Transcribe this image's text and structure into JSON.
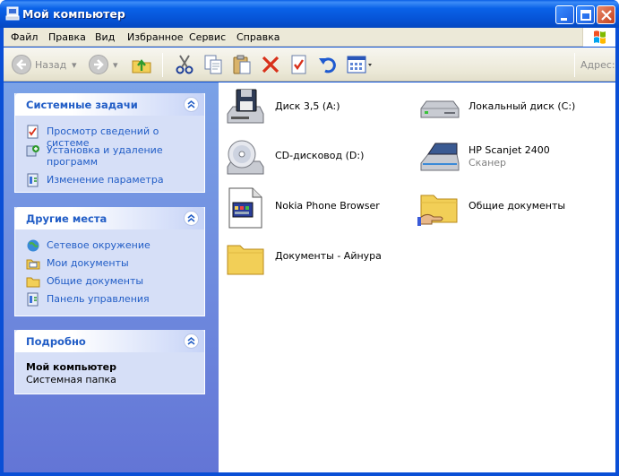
{
  "window": {
    "title": "Мой компьютер",
    "colors": {
      "titlebar": "#0a5ee6",
      "taskpane": "#6f8be0",
      "link": "#215dc6"
    }
  },
  "menu": {
    "items": [
      "Файл",
      "Правка",
      "Вид",
      "Избранное",
      "Сервис",
      "Справка"
    ]
  },
  "toolbar": {
    "back_label": "Назад",
    "address_label": "Адрес:",
    "icons": [
      "back-arrow-icon",
      "forward-arrow-icon",
      "folder-up-icon",
      "cut-icon",
      "copy-icon",
      "paste-icon",
      "delete-icon",
      "properties-icon",
      "undo-icon",
      "views-icon"
    ]
  },
  "sidebar": {
    "system_tasks": {
      "title": "Системные задачи",
      "items": [
        {
          "label": "Просмотр сведений о системе",
          "icon": "system-info-icon"
        },
        {
          "label": "Установка и удаление программ",
          "icon": "add-remove-icon"
        },
        {
          "label": "Изменение параметра",
          "icon": "control-panel-icon"
        }
      ]
    },
    "other_places": {
      "title": "Другие места",
      "items": [
        {
          "label": "Сетевое окружение",
          "icon": "network-icon"
        },
        {
          "label": "Мои документы",
          "icon": "my-documents-icon"
        },
        {
          "label": "Общие документы",
          "icon": "folder-icon"
        },
        {
          "label": "Панель управления",
          "icon": "control-panel-icon"
        }
      ]
    },
    "details": {
      "title": "Подробно",
      "name": "Мой компьютер",
      "type": "Системная папка"
    }
  },
  "content": {
    "items": [
      {
        "name": "Диск 3,5 (A:)",
        "sub": "",
        "icon": "floppy-drive-icon"
      },
      {
        "name": "Локальный диск (C:)",
        "sub": "",
        "icon": "hard-drive-icon"
      },
      {
        "name": "CD-дисковод (D:)",
        "sub": "",
        "icon": "cd-drive-icon"
      },
      {
        "name": "HP Scanjet 2400",
        "sub": "Сканер",
        "icon": "scanner-icon"
      },
      {
        "name": "Nokia Phone Browser",
        "sub": "",
        "icon": "nokia-browser-icon"
      },
      {
        "name": "Общие документы",
        "sub": "",
        "icon": "shared-folder-icon"
      },
      {
        "name": "Документы - Айнура",
        "sub": "",
        "icon": "folder-icon"
      }
    ]
  }
}
